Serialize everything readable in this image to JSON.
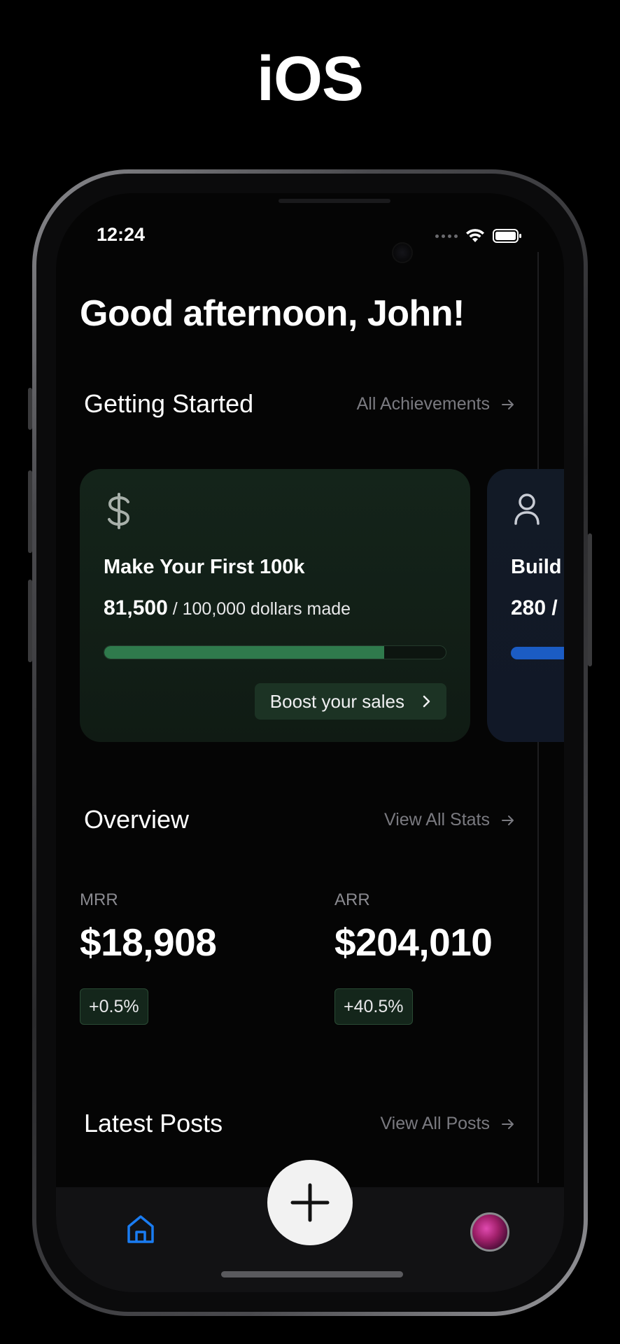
{
  "platform_label": "iOS",
  "status_bar": {
    "time": "12:24"
  },
  "greeting": "Good afternoon, John!",
  "getting_started": {
    "title": "Getting Started",
    "link_label": "All Achievements",
    "cards": [
      {
        "icon": "dollar-icon",
        "title": "Make Your First 100k",
        "current": "81,500",
        "suffix": "/ 100,000 dollars made",
        "progress": 0.82,
        "accent_color": "#2f7a4c",
        "button_label": "Boost your sales"
      },
      {
        "icon": "user-icon",
        "title": "Build",
        "current": "280 /",
        "accent_color": "#1b5cc4"
      }
    ]
  },
  "overview": {
    "title": "Overview",
    "link_label": "View All Stats",
    "stats": [
      {
        "label": "MRR",
        "value": "$18,908",
        "change": "+0.5%"
      },
      {
        "label": "ARR",
        "value": "$204,010",
        "change": "+40.5%"
      }
    ]
  },
  "latest_posts": {
    "title": "Latest Posts",
    "link_label": "View All Posts"
  },
  "tabbar": {
    "home_color": "#1a7cf2",
    "items": [
      "home-icon",
      "add-icon",
      "avatar"
    ]
  }
}
